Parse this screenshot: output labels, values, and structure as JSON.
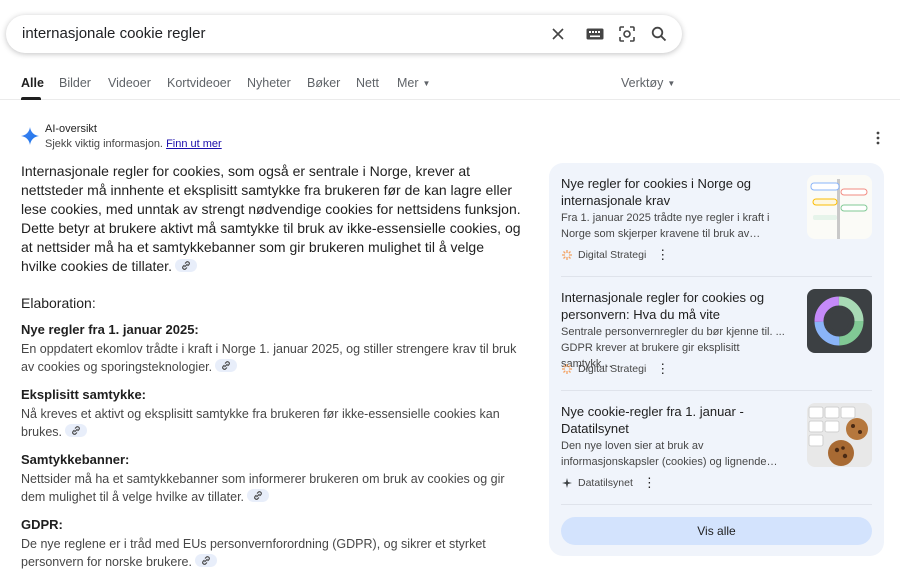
{
  "search": {
    "query": "internasjonale cookie regler"
  },
  "tabs": {
    "items": [
      "Alle",
      "Bilder",
      "Videoer",
      "Kortvideoer",
      "Nyheter",
      "Bøker",
      "Nett",
      "Mer"
    ],
    "tools": "Verktøy"
  },
  "ai_overview": {
    "title": "AI-oversikt",
    "subtitle": "Sjekk viktig informasjon.",
    "learn_more": "Finn ut mer",
    "intro": "Internasjonale regler for cookies, som også er sentrale i Norge, krever at nettsteder må innhente et eksplisitt samtykke fra brukeren før de kan lagre eller lese cookies, med unntak av strengt nødvendige cookies for nettsidens funksjon. Dette betyr at brukere aktivt må samtykke til bruk av ikke-essensielle cookies, og at nettsider må ha et samtykkebanner som gir brukeren mulighet til å velge hvilke cookies de tillater.",
    "section_heading": "Elaboration:",
    "items": [
      {
        "title": "Nye regler fra 1. januar 2025:",
        "body": "En oppdatert ekomlov trådte i kraft i Norge 1. januar 2025, og stiller strengere krav til bruk av cookies og sporingsteknologier."
      },
      {
        "title": "Eksplisitt samtykke:",
        "body": "Nå kreves et aktivt og eksplisitt samtykke fra brukeren før ikke-essensielle cookies kan brukes."
      },
      {
        "title": "Samtykkebanner:",
        "body": "Nettsider må ha et samtykkebanner som informerer brukeren om bruk av cookies og gir dem mulighet til å velge hvilke av tillater."
      },
      {
        "title": "GDPR:",
        "body": "De nye reglene er i tråd med EUs personvernforordning (GDPR), og sikrer et styrket personvern for norske brukere."
      }
    ]
  },
  "sources": {
    "cards": [
      {
        "title": "Nye regler for cookies i Norge og internasjonale krav",
        "snippet": "Fra 1. januar 2025 trådte nye regler i kraft i Norge som skjerper kravene til bruk av…",
        "source": "Digital Strategi"
      },
      {
        "title": "Internasjonale regler for cookies og personvern: Hva du må vite",
        "snippet": "Sentrale personvernregler du bør kjenne til. ... GDPR krever at brukere gir eksplisitt samtykk…",
        "source": "Digital Strategi"
      },
      {
        "title": "Nye cookie-regler fra 1. januar - Datatilsynet",
        "snippet": "Den nye loven sier at bruk av informasjonskapsler (cookies) og lignende…",
        "source": "Datatilsynet"
      }
    ],
    "show_all": "Vis alle"
  },
  "colors": {
    "accent": "#1a73e8",
    "panel": "#f0f4fb",
    "button": "#d3e3fd"
  }
}
